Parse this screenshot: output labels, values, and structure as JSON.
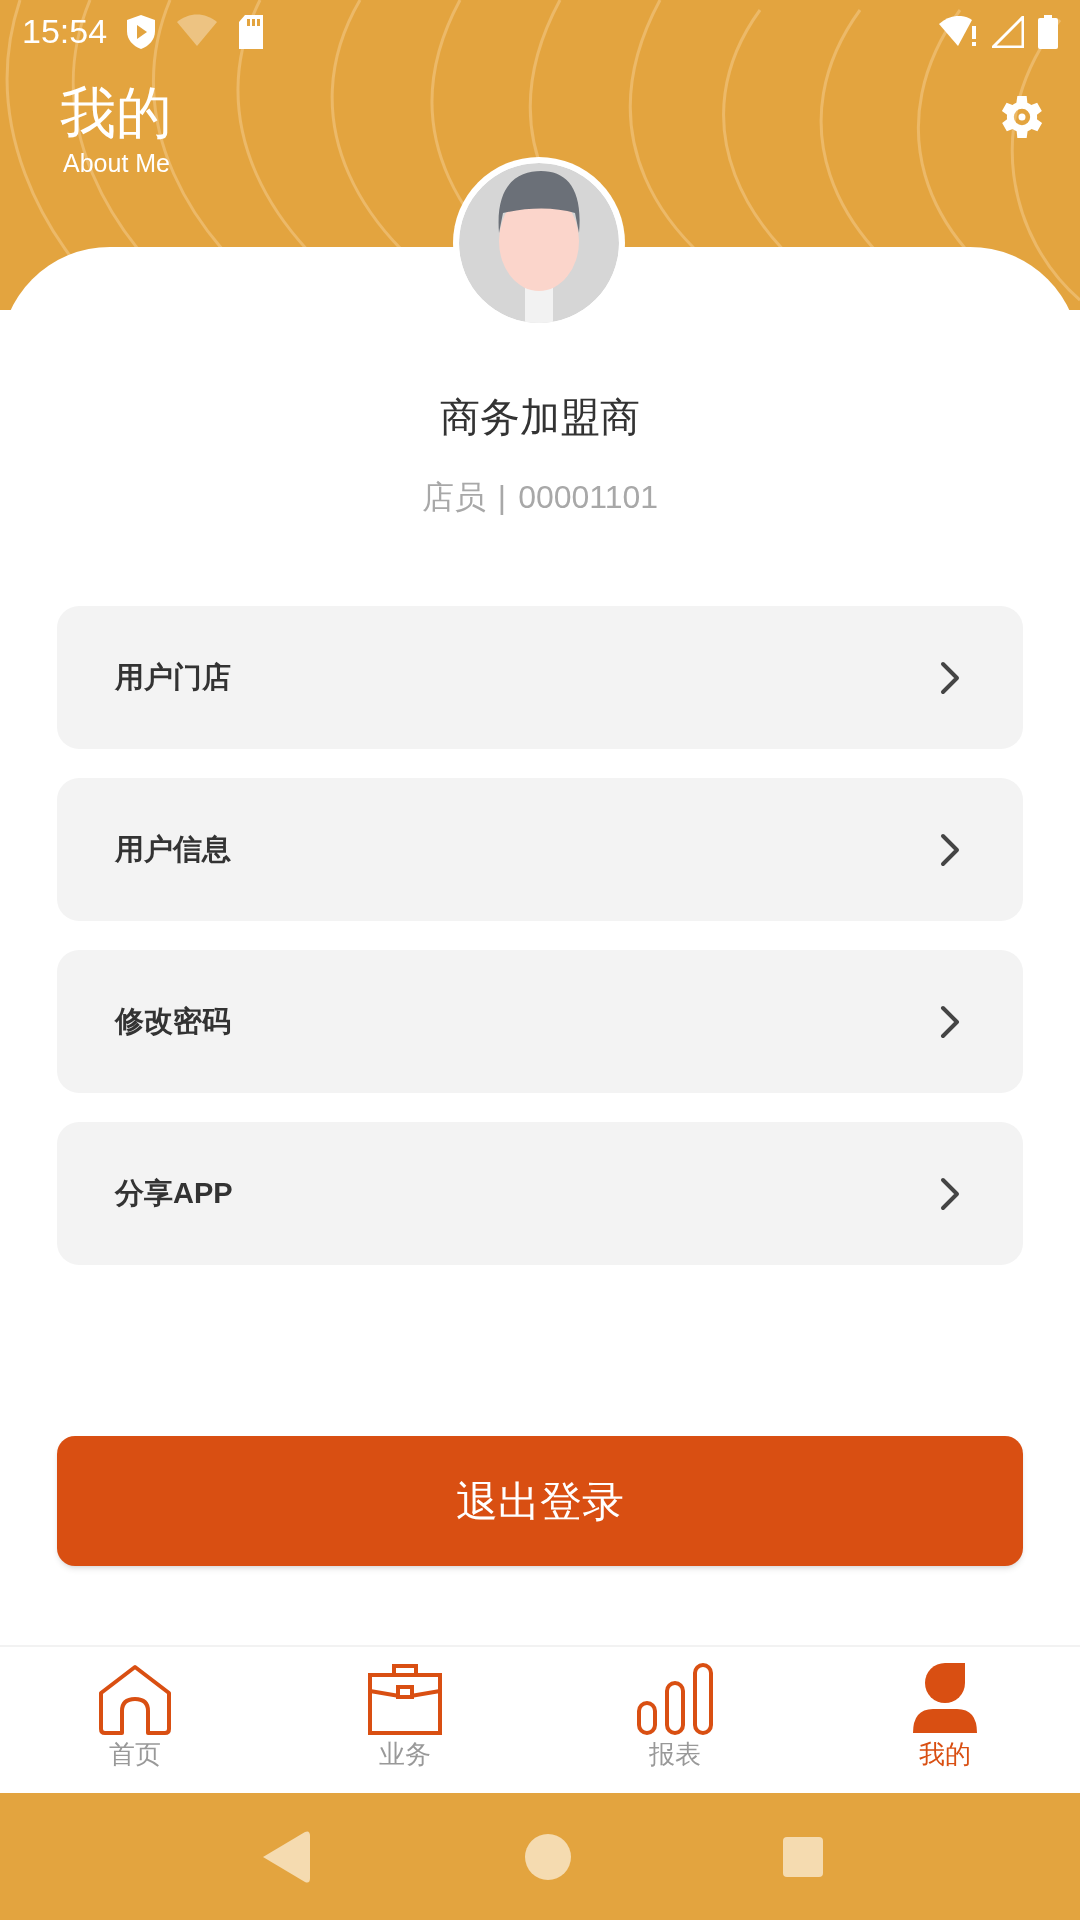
{
  "status_bar": {
    "time": "15:54"
  },
  "header": {
    "title": "我的",
    "subtitle": "About Me"
  },
  "profile": {
    "name": "商务加盟商",
    "role": "店员",
    "separator": "|",
    "id": "00001101"
  },
  "menu": [
    {
      "label": "用户门店"
    },
    {
      "label": "用户信息"
    },
    {
      "label": "修改密码"
    },
    {
      "label": "分享APP"
    }
  ],
  "logout_button": "退出登录",
  "tabs": [
    {
      "label": "首页",
      "kind": "home",
      "selected": false
    },
    {
      "label": "业务",
      "kind": "business",
      "selected": false
    },
    {
      "label": "报表",
      "kind": "report",
      "selected": false
    },
    {
      "label": "我的",
      "kind": "me",
      "selected": true
    }
  ]
}
